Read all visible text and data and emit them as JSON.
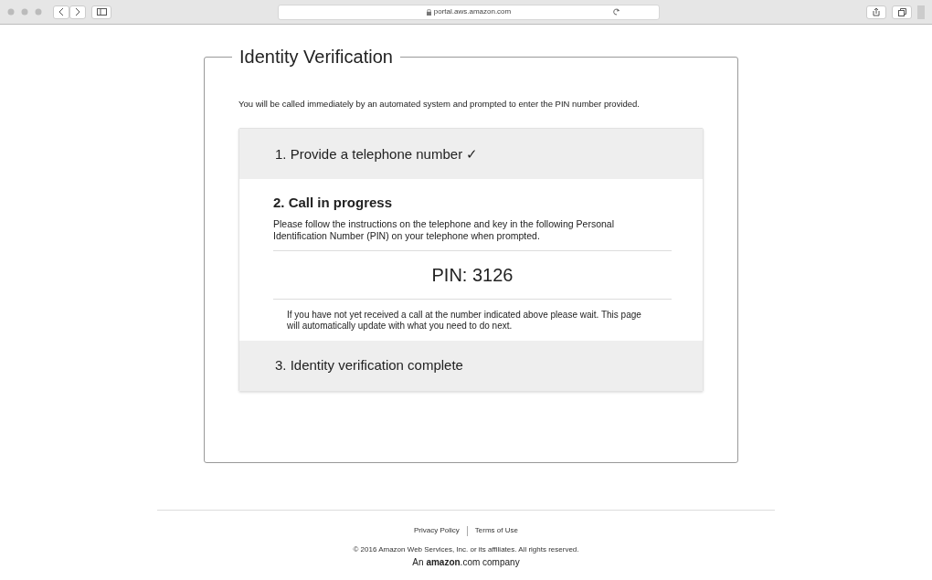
{
  "browser": {
    "url": "portal.aws.amazon.com"
  },
  "panel": {
    "title": "Identity Verification",
    "intro": "You will be called immediately by an automated system and prompted to enter the PIN number provided.",
    "steps": [
      {
        "title": "1. Provide a telephone number ✓",
        "expanded": false
      },
      {
        "title": "2. Call in progress",
        "expanded": true,
        "instructions": "Please follow the instructions on the telephone and key in the following Personal Identification Number (PIN) on your telephone when prompted.",
        "pin": "PIN: 3126",
        "note": "If you have not yet received a call at the number indicated above please wait. This page will automatically update with what you need to do next."
      },
      {
        "title": "3. Identity verification complete",
        "expanded": false
      }
    ]
  },
  "footer": {
    "links": [
      "Privacy Policy",
      "Terms of Use"
    ],
    "copyright": "© 2016 Amazon Web Services, Inc. or its affiliates. All rights reserved.",
    "company": "An **amazon**.com company"
  }
}
